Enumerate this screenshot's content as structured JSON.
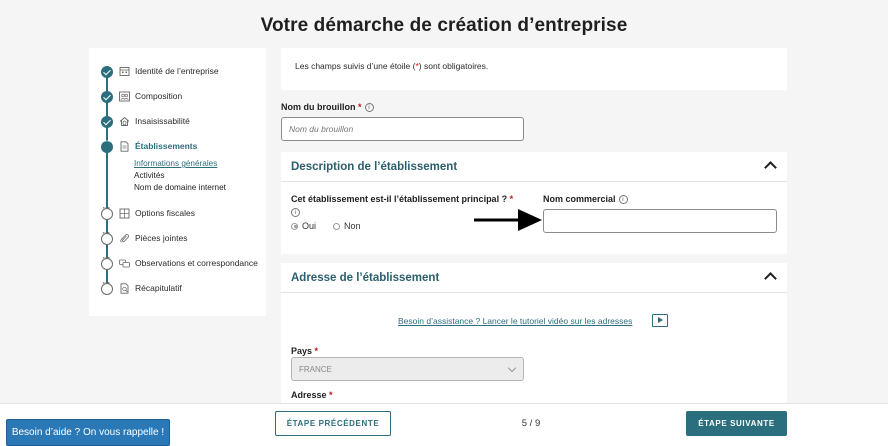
{
  "page_title": "Votre démarche de création d’entreprise",
  "sidebar": {
    "steps": [
      {
        "label": "Identité de l’entreprise",
        "state": "done",
        "icon": "building-icon"
      },
      {
        "label": "Composition",
        "state": "done",
        "icon": "people-icon"
      },
      {
        "label": "Insaisissabilité",
        "state": "done",
        "icon": "home-shield-icon"
      },
      {
        "label": "Établissements",
        "state": "current",
        "icon": "document-icon"
      },
      {
        "label": "Options fiscales",
        "state": "todo",
        "icon": "calculator-icon"
      },
      {
        "label": "Pièces jointes",
        "state": "todo",
        "icon": "paperclip-icon"
      },
      {
        "label": "Observations et correspondance",
        "state": "todo",
        "icon": "messages-icon"
      },
      {
        "label": "Récapitulatif",
        "state": "todo",
        "icon": "summary-icon"
      }
    ],
    "substeps": [
      "Informations générales",
      "Activités",
      "Nom de domaine internet"
    ]
  },
  "notice": {
    "before": "Les champs suivis d’une étoile (",
    "star": "*",
    "after": ") sont obligatoires."
  },
  "draft": {
    "label": "Nom du brouillon",
    "placeholder": "Nom du brouillon",
    "value": ""
  },
  "description_section": {
    "title": "Description de l’établissement",
    "principal_question": "Cet établissement est-il l’établissement principal ?",
    "options": [
      "Oui",
      "Non"
    ],
    "selected": "Oui",
    "commercial_name_label": "Nom commercial",
    "commercial_name_value": ""
  },
  "address_section": {
    "title": "Adresse de l’établissement",
    "tutorial_link": "Besoin d’assistance ? Lancer le tutoriel vidéo sur les adresses",
    "country_label": "Pays",
    "country_value": "FRANCE",
    "address_label": "Adresse"
  },
  "footer": {
    "help_button": "Besoin d’aide ? On vous rappelle !",
    "prev_button": "ÉTAPE PRÉCÉDENTE",
    "next_button": "ÉTAPE SUIVANTE",
    "pager": "5 / 9"
  },
  "colors": {
    "accent": "#2b6e7e",
    "required": "#c1121f",
    "help": "#2b78b7"
  }
}
